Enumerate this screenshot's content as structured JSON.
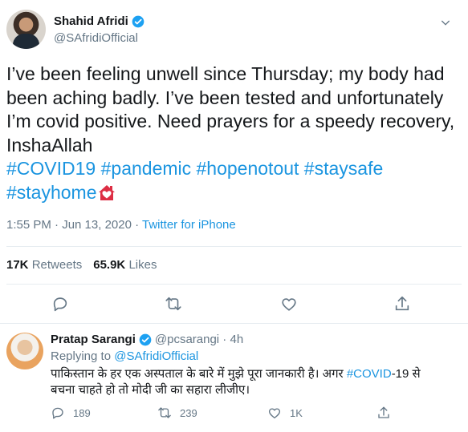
{
  "tweet": {
    "author_name": "Shahid Afridi",
    "author_handle": "@SAfridiOfficial",
    "text_lines": [
      "I’ve been feeling unwell since Thursday; my body had",
      "been aching badly. I’ve been tested and unfortunately",
      "I’m covid positive. Need prayers for a speedy recovery,",
      "InshaAllah"
    ],
    "hashtags_line1": "#COVID19 #pandemic #hopenotout #staysafe",
    "hashtags_line2": "#stayhome",
    "timestamp": "1:55 PM · Jun 13, 2020 · ",
    "source": "Twitter for iPhone",
    "retweets_count": "17K",
    "retweets_label": "Retweets",
    "likes_count": "65.9K",
    "likes_label": "Likes"
  },
  "reply": {
    "author_name": "Pratap Sarangi",
    "author_handle": "@pcsarangi · 4h",
    "replying_label": "Replying to ",
    "replying_to": "@SAfridiOfficial",
    "text_line1_a": "पाकिस्तान के हर एक अस्पताल के बारे में मुझे पूरा जानकारी है। अगर ",
    "text_line1_tag": "#COVID",
    "text_line1_b": "-19 से",
    "text_line2": "बचना चाहते हो तो मोदी जी का सहारा लीजीए।",
    "reply_count": "189",
    "retweet_count": "239",
    "like_count": "1K"
  },
  "colors": {
    "link": "#1b95e0",
    "muted": "#657786",
    "text": "#14171a",
    "divider": "#e6ecf0"
  },
  "icons": [
    "verified-badge-icon",
    "chevron-down-icon",
    "reply-icon",
    "retweet-icon",
    "like-icon",
    "share-icon",
    "house-heart-emoji-icon"
  ]
}
